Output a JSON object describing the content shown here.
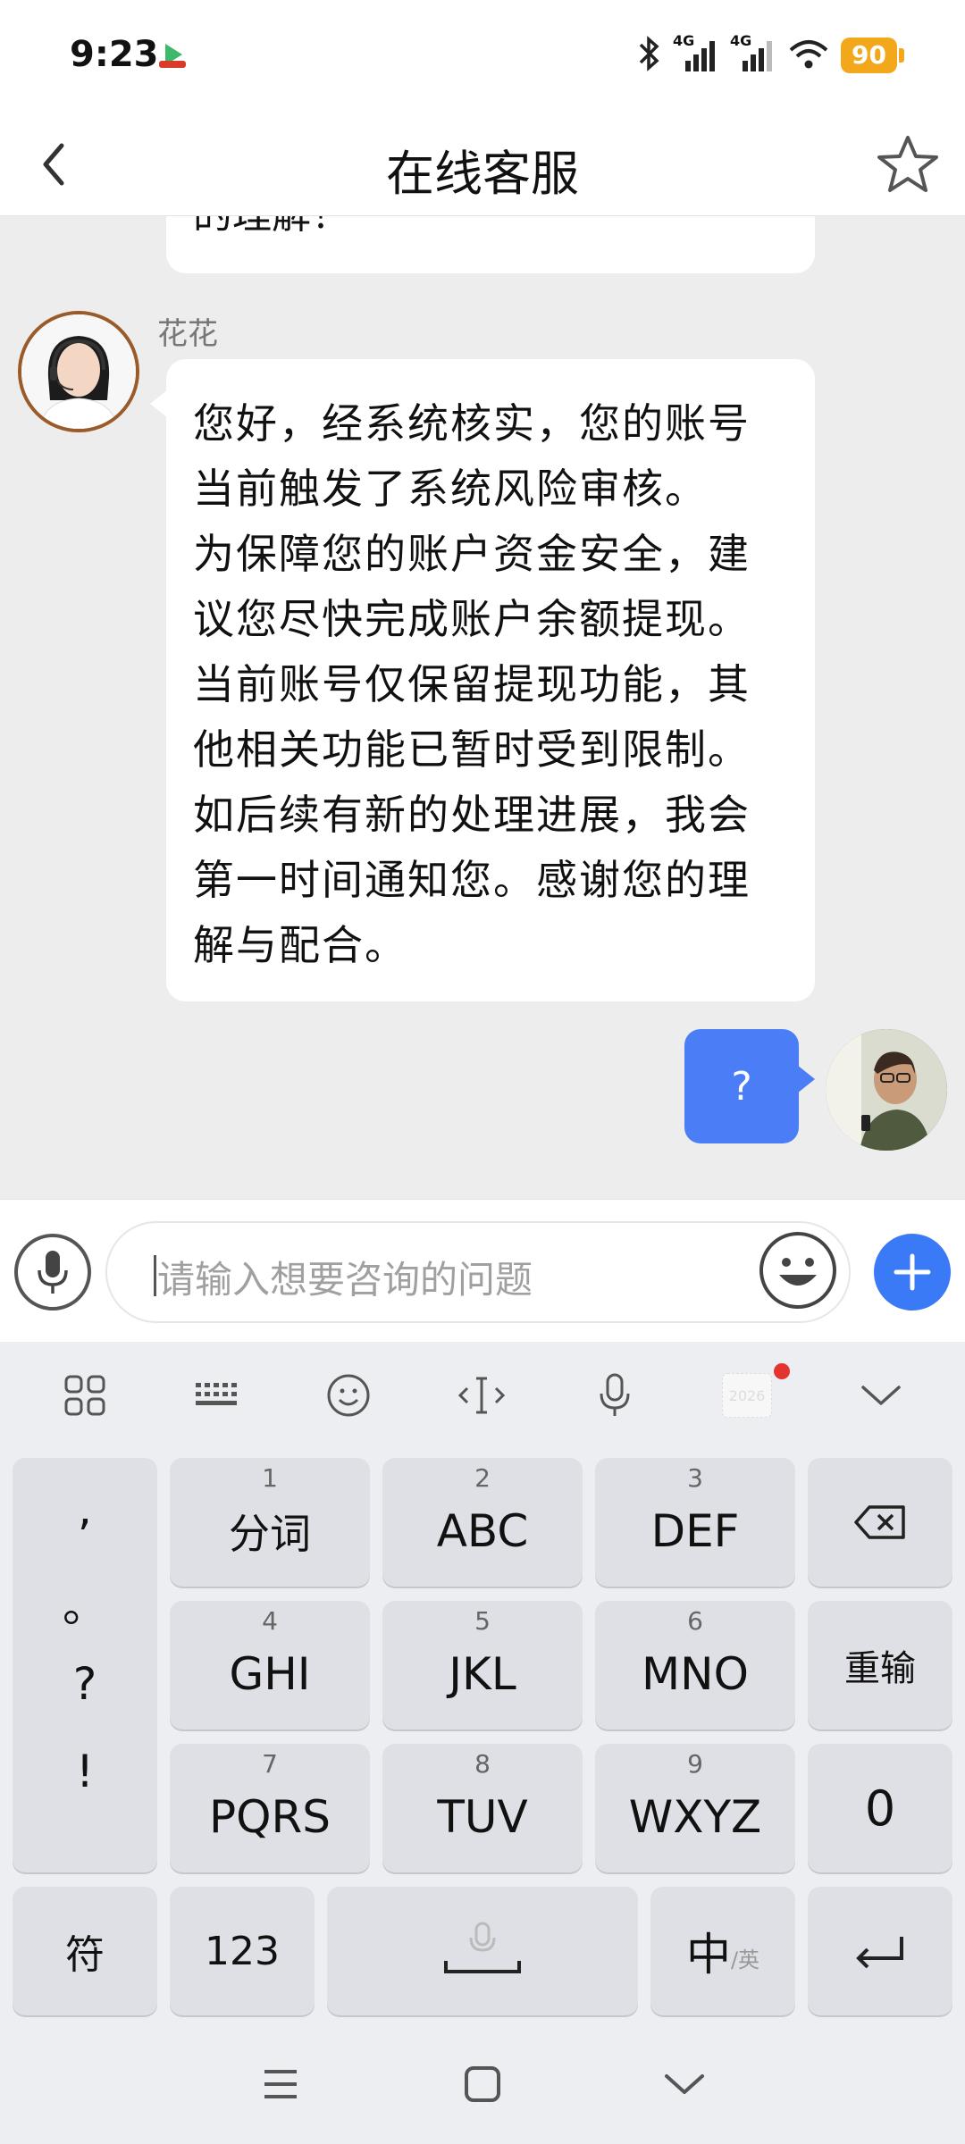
{
  "status_bar": {
    "time": "9:23",
    "network_1": "4G",
    "network_2": "4G",
    "battery": "90"
  },
  "header": {
    "title": "在线客服"
  },
  "chat": {
    "previous_fragment": "的理解！",
    "agent_name": "花花",
    "agent_message_lines": [
      "您好，经系统核实，您的账号",
      "当前触发了系统风险审核。",
      "为保障您的账户资金安全，建",
      "议您尽快完成账户余额提现。",
      "当前账号仅保留提现功能，其",
      "他相关功能已暂时受到限制。",
      "如后续有新的处理进展，我会",
      "第一时间通知您。感谢您的理",
      "解与配合。"
    ],
    "user_message": "?"
  },
  "input": {
    "placeholder": "请输入想要咨询的问题"
  },
  "keyboard": {
    "punctuation": [
      ",",
      "。",
      "?",
      "!"
    ],
    "keys": [
      {
        "num": "1",
        "label": "分词"
      },
      {
        "num": "2",
        "label": "ABC"
      },
      {
        "num": "3",
        "label": "DEF"
      },
      {
        "num": "4",
        "label": "GHI"
      },
      {
        "num": "5",
        "label": "JKL"
      },
      {
        "num": "6",
        "label": "MNO"
      },
      {
        "num": "7",
        "label": "PQRS"
      },
      {
        "num": "8",
        "label": "TUV"
      },
      {
        "num": "9",
        "label": "WXYZ"
      }
    ],
    "reinput": "重输",
    "zero": "0",
    "symbols": "符",
    "num_mode": "123",
    "lang_main": "中",
    "lang_sub": "/英",
    "toolbar_year": "2026"
  },
  "colors": {
    "accent_blue": "#4b7ef6",
    "battery": "#f3a81c",
    "chat_bg": "#ededed",
    "keyboard_bg": "#edeef2"
  }
}
